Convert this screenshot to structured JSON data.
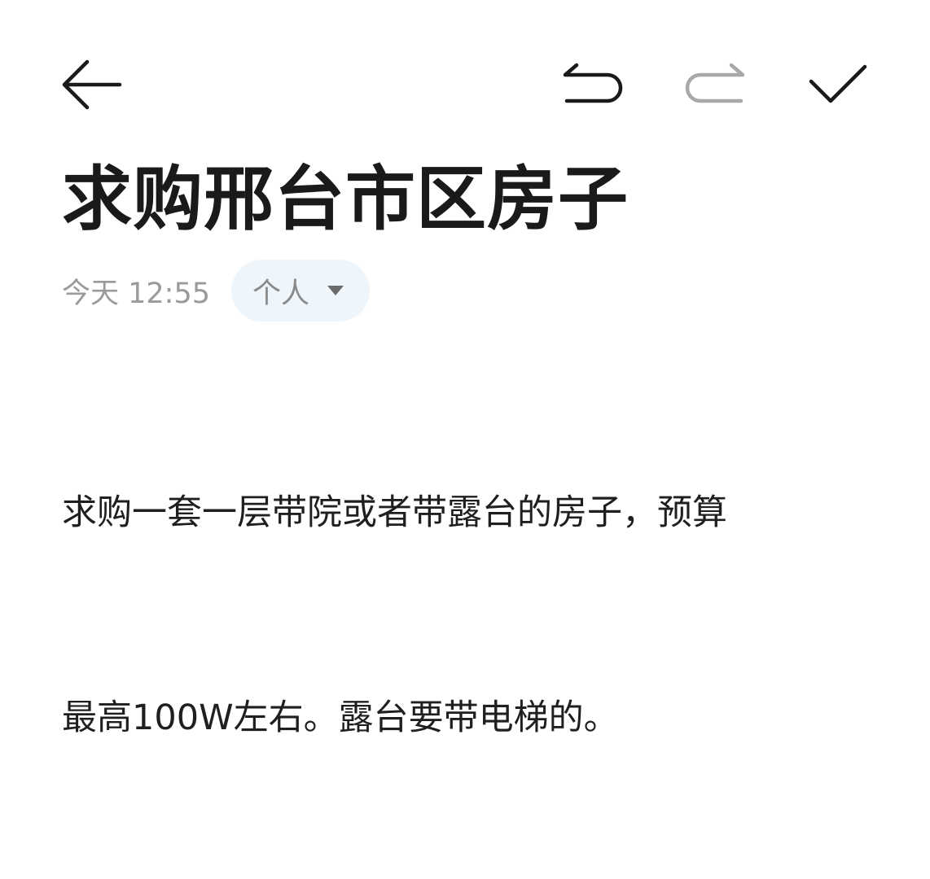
{
  "toolbar": {
    "back_icon": "arrow-left-icon",
    "undo_icon": "undo-icon",
    "redo_icon": "redo-icon",
    "done_icon": "checkmark-icon",
    "redo_disabled": true
  },
  "note": {
    "title": "求购邢台市区房子",
    "timestamp": "今天 12:55",
    "folder": "个人",
    "folder_dropdown_icon": "triangle-down-icon",
    "body_line1": "求购一套一层带院或者带露台的房子，预算",
    "body_line2": "最高100W左右。露台要带电梯的。"
  },
  "colors": {
    "text_primary": "#1a1a1a",
    "text_secondary": "#9a9a9a",
    "pill_background": "#eef5fb",
    "disabled_icon": "#a8a8a8"
  }
}
